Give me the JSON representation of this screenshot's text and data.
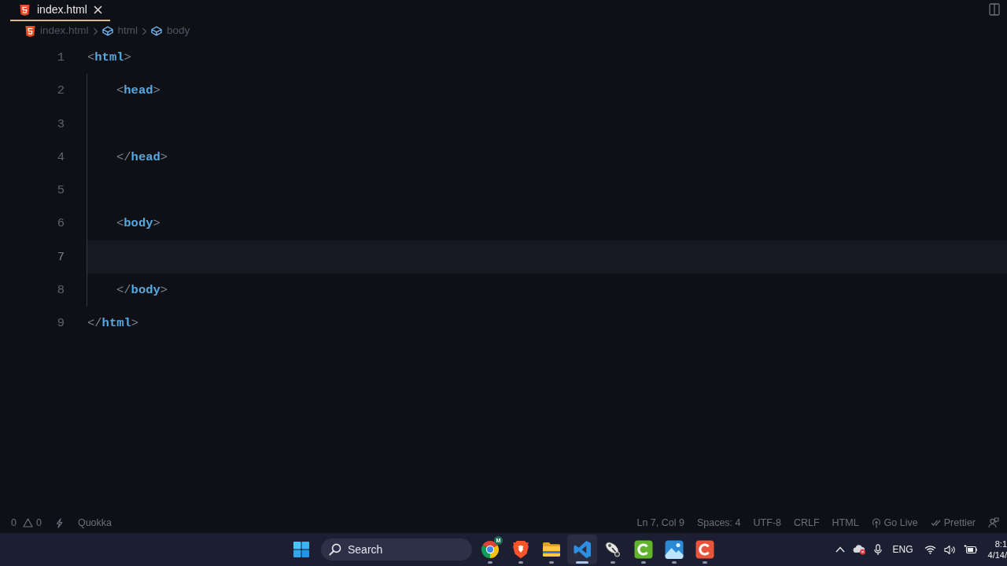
{
  "tabs": [
    {
      "label": "index.html",
      "selected": true
    }
  ],
  "breadcrumb": [
    {
      "kind": "file",
      "label": "index.html"
    },
    {
      "kind": "element",
      "label": "html"
    },
    {
      "kind": "element",
      "label": "body"
    }
  ],
  "editor": {
    "lines": [
      {
        "number": "1",
        "indented": false,
        "current": false,
        "tokens": [
          {
            "kind": "punct",
            "text": "<"
          },
          {
            "kind": "tag",
            "text": "html"
          },
          {
            "kind": "punct",
            "text": ">"
          }
        ]
      },
      {
        "number": "2",
        "indented": true,
        "current": false,
        "tokens": [
          {
            "kind": "punct",
            "text": "<"
          },
          {
            "kind": "tag",
            "text": "head"
          },
          {
            "kind": "punct",
            "text": ">"
          }
        ]
      },
      {
        "number": "3",
        "indented": true,
        "current": false
      },
      {
        "number": "4",
        "indented": true,
        "current": false,
        "tokens": [
          {
            "kind": "punct",
            "text": "</"
          },
          {
            "kind": "tag",
            "text": "head"
          },
          {
            "kind": "punct",
            "text": ">"
          }
        ]
      },
      {
        "number": "5",
        "indented": true,
        "current": false
      },
      {
        "number": "6",
        "indented": true,
        "current": false,
        "tokens": [
          {
            "kind": "punct",
            "text": "<"
          },
          {
            "kind": "tag",
            "text": "body"
          },
          {
            "kind": "punct",
            "text": ">"
          }
        ]
      },
      {
        "number": "7",
        "indented": true,
        "current": true
      },
      {
        "number": "8",
        "indented": true,
        "current": false,
        "tokens": [
          {
            "kind": "punct",
            "text": "</"
          },
          {
            "kind": "tag",
            "text": "body"
          },
          {
            "kind": "punct",
            "text": ">"
          }
        ]
      },
      {
        "number": "9",
        "indented": false,
        "current": false,
        "tokens": [
          {
            "kind": "punct",
            "text": "</"
          },
          {
            "kind": "tag",
            "text": "html"
          },
          {
            "kind": "punct",
            "text": ">"
          }
        ]
      }
    ]
  },
  "status_bar": {
    "left": [
      {
        "kind": "text",
        "text": "0"
      },
      {
        "kind": "warnings",
        "text": "0"
      },
      {
        "kind": "bolt"
      },
      {
        "kind": "text",
        "text": "Quokka"
      }
    ],
    "right": [
      {
        "kind": "text",
        "text": "Ln 7, Col 9"
      },
      {
        "kind": "text",
        "text": "Spaces: 4"
      },
      {
        "kind": "text",
        "text": "UTF-8"
      },
      {
        "kind": "text",
        "text": "CRLF"
      },
      {
        "kind": "text",
        "text": "HTML"
      },
      {
        "kind": "live",
        "text": "Go Live"
      },
      {
        "kind": "prettier",
        "text": "Prettier"
      },
      {
        "kind": "feedback"
      }
    ]
  },
  "taskbar": {
    "search": {
      "placeholder": "Search"
    },
    "apps": [
      {
        "kind": "roundlogo",
        "badge": "M",
        "selected": false
      },
      {
        "kind": "shield",
        "selected": false
      },
      {
        "kind": "folder",
        "selected": false
      },
      {
        "kind": "ribbon",
        "selected": true
      },
      {
        "kind": "dish",
        "selected": false
      },
      {
        "kind": "greentile",
        "selected": false
      },
      {
        "kind": "photo",
        "selected": false
      },
      {
        "kind": "redtile",
        "selected": false
      }
    ],
    "tray": [
      {
        "kind": "chevron"
      },
      {
        "kind": "cloud"
      },
      {
        "kind": "mic"
      },
      {
        "kind": "language",
        "text": "ENG"
      },
      {
        "kind": "wifi"
      },
      {
        "kind": "volume"
      },
      {
        "kind": "battery"
      }
    ],
    "clock": {
      "time": "8:1",
      "date": "4/14/"
    }
  }
}
